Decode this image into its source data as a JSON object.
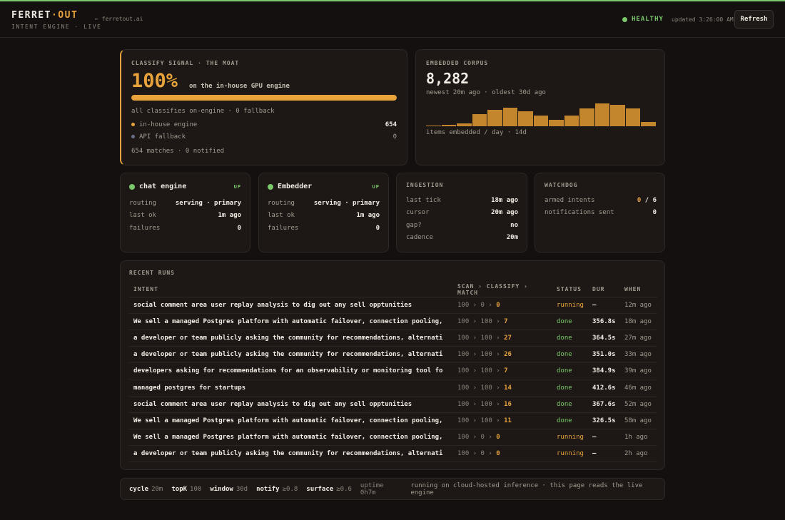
{
  "header": {
    "brand_main": "FERRET",
    "brand_dot": "·",
    "brand_suffix": "OUT",
    "tagline": "INTENT ENGINE · LIVE",
    "back_link": "← ferretout.ai",
    "health": "HEALTHY",
    "updated": "updated 3:26:00 AM",
    "refresh_label": "Refresh"
  },
  "classify": {
    "label": "CLASSIFY SIGNAL · THE MOAT",
    "pct": "100%",
    "pct_value": 1.0,
    "pct_sub": "on the in-house GPU engine",
    "summary": "all classifies on-engine · 0 fallback",
    "rows": [
      {
        "label": "in-house engine",
        "value": "654",
        "dot_color": "#e8a33c"
      },
      {
        "label": "API fallback",
        "value": "0",
        "dot_color": "#6b6f86"
      }
    ],
    "footer": "654 matches · 0 notified"
  },
  "corpus": {
    "label": "EMBEDDED CORPUS",
    "count": "8,282",
    "sub": "newest 20m ago · oldest 30d ago",
    "histogram": [
      1,
      2,
      4,
      16,
      22,
      24,
      20,
      14,
      8,
      14,
      23,
      30,
      28,
      23,
      6
    ],
    "caption": "items embedded / day · 14d"
  },
  "services": [
    {
      "name": "chat engine",
      "status": "UP",
      "rows": [
        {
          "k": "routing",
          "v": "serving · primary"
        },
        {
          "k": "last ok",
          "v": "1m ago"
        },
        {
          "k": "failures",
          "v": "0"
        }
      ]
    },
    {
      "name": "Embedder",
      "status": "UP",
      "rows": [
        {
          "k": "routing",
          "v": "serving · primary"
        },
        {
          "k": "last ok",
          "v": "1m ago"
        },
        {
          "k": "failures",
          "v": "0"
        }
      ]
    }
  ],
  "ingestion": {
    "label": "INGESTION",
    "rows": [
      {
        "k": "last tick",
        "v": "18m ago"
      },
      {
        "k": "cursor",
        "v": "20m ago"
      },
      {
        "k": "gap?",
        "v": "no"
      },
      {
        "k": "cadence",
        "v": "20m"
      }
    ]
  },
  "watchdog": {
    "label": "WATCHDOG",
    "armed_label": "armed intents",
    "armed_value": "0",
    "armed_total": "/ 6",
    "sent_label": "notifications sent",
    "sent_value": "0"
  },
  "runs": {
    "label": "RECENT RUNS",
    "columns": [
      "INTENT",
      "SCAN › CLASSIFY › MATCH",
      "STATUS",
      "DUR",
      "WHEN"
    ],
    "rows": [
      {
        "intent": "social comment area user replay analysis to dig out any sell opptunities",
        "scan": "100",
        "classify": "0",
        "match": "0",
        "status": "running",
        "dur": "—",
        "when": "12m ago"
      },
      {
        "intent": "We sell a managed Postgres platform with automatic failover, connection pooling,",
        "scan": "100",
        "classify": "100",
        "match": "7",
        "status": "done",
        "dur": "356.8s",
        "when": "18m ago"
      },
      {
        "intent": "a developer or team publicly asking the community for recommendations, alternati",
        "scan": "100",
        "classify": "100",
        "match": "27",
        "status": "done",
        "dur": "364.5s",
        "when": "27m ago"
      },
      {
        "intent": "a developer or team publicly asking the community for recommendations, alternati",
        "scan": "100",
        "classify": "100",
        "match": "26",
        "status": "done",
        "dur": "351.0s",
        "when": "33m ago"
      },
      {
        "intent": "developers asking for recommendations for an observability or monitoring tool fo",
        "scan": "100",
        "classify": "100",
        "match": "7",
        "status": "done",
        "dur": "384.9s",
        "when": "39m ago"
      },
      {
        "intent": "managed postgres for startups",
        "scan": "100",
        "classify": "100",
        "match": "14",
        "status": "done",
        "dur": "412.6s",
        "when": "46m ago"
      },
      {
        "intent": "social comment area user replay analysis to dig out any sell opptunities",
        "scan": "100",
        "classify": "100",
        "match": "16",
        "status": "done",
        "dur": "367.6s",
        "when": "52m ago"
      },
      {
        "intent": "We sell a managed Postgres platform with automatic failover, connection pooling,",
        "scan": "100",
        "classify": "100",
        "match": "11",
        "status": "done",
        "dur": "326.5s",
        "when": "58m ago"
      },
      {
        "intent": "We sell a managed Postgres platform with automatic failover, connection pooling,",
        "scan": "100",
        "classify": "0",
        "match": "0",
        "status": "running",
        "dur": "—",
        "when": "1h ago"
      },
      {
        "intent": "a developer or team publicly asking the community for recommendations, alternati",
        "scan": "100",
        "classify": "0",
        "match": "0",
        "status": "running",
        "dur": "—",
        "when": "2h ago"
      }
    ]
  },
  "footer": {
    "items": [
      {
        "k": "cycle",
        "v": "20m"
      },
      {
        "k": "topK",
        "v": "100"
      },
      {
        "k": "window",
        "v": "30d"
      },
      {
        "k": "notify",
        "v": "≥0.8"
      },
      {
        "k": "surface",
        "v": "≥0.6"
      }
    ],
    "uptime": "uptime 0h7m",
    "note": "running on cloud-hosted inference · this page reads the live engine"
  },
  "colors": {
    "accent": "#e8a33c",
    "ok": "#7bc86a",
    "background": "#141010"
  }
}
